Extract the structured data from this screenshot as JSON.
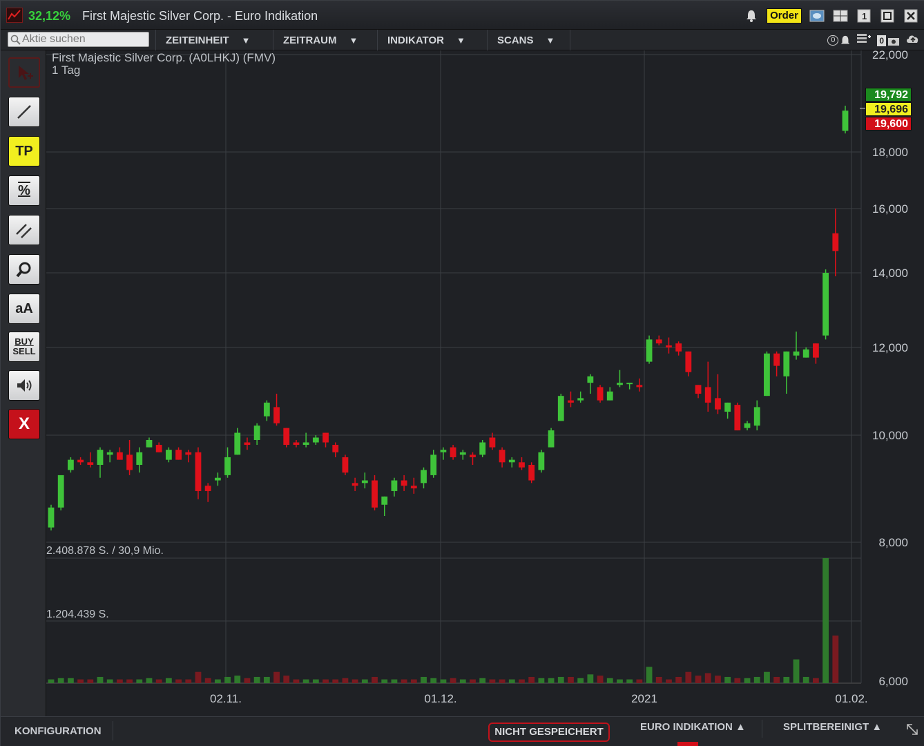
{
  "titlebar": {
    "change_pct": "32,12%",
    "title": "First Majestic Silver Corp. - Euro Indikation",
    "order_label": "Order"
  },
  "toolbar": {
    "search_placeholder": "Aktie suchen",
    "menus": [
      "ZEITEINHEIT",
      "ZEITRAUM",
      "INDIKATOR",
      "SCANS"
    ],
    "counter_a": "0",
    "counter_b": "0"
  },
  "tools": {
    "tp_label": "TP",
    "percent_label": "%",
    "text_label": "aA",
    "buy_label": "BUY",
    "sell_label": "SELL",
    "close_label": "X"
  },
  "chart": {
    "title_line1": "First Majestic Silver Corp. (A0LHKJ) (FMV)",
    "title_line2": "1 Tag",
    "volume_max_label": "2.408.878 S. / 30,9 Mio.",
    "volume_mid_label": "1.204.439 S.",
    "price_tags": {
      "high": "19,792",
      "last": "19,696",
      "low": "19,600"
    }
  },
  "colors": {
    "up": "#3fc33a",
    "down": "#e0101a",
    "background": "#1f2125",
    "grid": "#3b3e44",
    "accent_yellow": "#f2e416"
  },
  "chart_data": {
    "type": "candlestick",
    "title": "First Majestic Silver Corp. (A0LHKJ) (FMV)",
    "subtitle": "1 Tag",
    "y_ticks": [
      "22,000",
      "18,000",
      "16,000",
      "14,000",
      "12,000",
      "10,000",
      "8,000",
      "6,000"
    ],
    "x_ticks": [
      "02.11.",
      "01.12.",
      "2021",
      "01.02."
    ],
    "y_scale": "log",
    "ylim": [
      6.0,
      22.0
    ],
    "candles": [
      {
        "o": 8.25,
        "h": 8.65,
        "l": 8.2,
        "c": 8.6,
        "v": 0.03
      },
      {
        "o": 8.6,
        "h": 8.75,
        "l": 8.55,
        "c": 9.2,
        "v": 0.04
      },
      {
        "o": 9.3,
        "h": 9.55,
        "l": 9.25,
        "c": 9.5,
        "v": 0.04
      },
      {
        "o": 9.5,
        "h": 9.55,
        "l": 9.4,
        "c": 9.45,
        "v": 0.03
      },
      {
        "o": 9.45,
        "h": 9.65,
        "l": 9.35,
        "c": 9.4,
        "v": 0.03
      },
      {
        "o": 9.4,
        "h": 9.75,
        "l": 9.15,
        "c": 9.7,
        "v": 0.05
      },
      {
        "o": 9.6,
        "h": 9.7,
        "l": 9.45,
        "c": 9.65,
        "v": 0.03
      },
      {
        "o": 9.65,
        "h": 9.75,
        "l": 9.5,
        "c": 9.5,
        "v": 0.03
      },
      {
        "o": 9.6,
        "h": 9.9,
        "l": 9.2,
        "c": 9.3,
        "v": 0.03
      },
      {
        "o": 9.4,
        "h": 9.75,
        "l": 9.25,
        "c": 9.65,
        "v": 0.03
      },
      {
        "o": 9.75,
        "h": 9.95,
        "l": 9.75,
        "c": 9.9,
        "v": 0.04
      },
      {
        "o": 9.8,
        "h": 9.85,
        "l": 9.65,
        "c": 9.65,
        "v": 0.03
      },
      {
        "o": 9.5,
        "h": 9.75,
        "l": 9.45,
        "c": 9.7,
        "v": 0.04
      },
      {
        "o": 9.7,
        "h": 9.75,
        "l": 9.5,
        "c": 9.5,
        "v": 0.03
      },
      {
        "o": 9.65,
        "h": 9.7,
        "l": 9.45,
        "c": 9.6,
        "v": 0.03
      },
      {
        "o": 9.65,
        "h": 9.75,
        "l": 8.75,
        "c": 8.9,
        "v": 0.09
      },
      {
        "o": 9.0,
        "h": 9.05,
        "l": 8.7,
        "c": 8.9,
        "v": 0.04
      },
      {
        "o": 9.1,
        "h": 9.25,
        "l": 9.0,
        "c": 9.15,
        "v": 0.03
      },
      {
        "o": 9.2,
        "h": 9.75,
        "l": 9.15,
        "c": 9.55,
        "v": 0.05
      },
      {
        "o": 9.6,
        "h": 10.15,
        "l": 9.6,
        "c": 10.05,
        "v": 0.06
      },
      {
        "o": 9.85,
        "h": 9.95,
        "l": 9.7,
        "c": 9.8,
        "v": 0.04
      },
      {
        "o": 9.9,
        "h": 10.25,
        "l": 9.8,
        "c": 10.2,
        "v": 0.05
      },
      {
        "o": 10.4,
        "h": 10.75,
        "l": 10.3,
        "c": 10.7,
        "v": 0.05
      },
      {
        "o": 10.6,
        "h": 10.9,
        "l": 10.2,
        "c": 10.25,
        "v": 0.09
      },
      {
        "o": 10.15,
        "h": 10.15,
        "l": 9.75,
        "c": 9.8,
        "v": 0.06
      },
      {
        "o": 9.85,
        "h": 9.9,
        "l": 9.75,
        "c": 9.8,
        "v": 0.03
      },
      {
        "o": 9.8,
        "h": 10.05,
        "l": 9.75,
        "c": 9.85,
        "v": 0.03
      },
      {
        "o": 9.85,
        "h": 10.0,
        "l": 9.8,
        "c": 9.95,
        "v": 0.03
      },
      {
        "o": 10.05,
        "h": 10.05,
        "l": 9.75,
        "c": 9.85,
        "v": 0.03
      },
      {
        "o": 9.8,
        "h": 9.85,
        "l": 9.55,
        "c": 9.65,
        "v": 0.03
      },
      {
        "o": 9.55,
        "h": 9.6,
        "l": 9.2,
        "c": 9.25,
        "v": 0.04
      },
      {
        "o": 9.05,
        "h": 9.15,
        "l": 8.9,
        "c": 9.0,
        "v": 0.03
      },
      {
        "o": 9.05,
        "h": 9.25,
        "l": 8.95,
        "c": 9.1,
        "v": 0.03
      },
      {
        "o": 9.1,
        "h": 9.2,
        "l": 8.55,
        "c": 8.6,
        "v": 0.05
      },
      {
        "o": 8.65,
        "h": 8.8,
        "l": 8.45,
        "c": 8.8,
        "v": 0.03
      },
      {
        "o": 8.9,
        "h": 9.15,
        "l": 8.8,
        "c": 9.1,
        "v": 0.03
      },
      {
        "o": 9.1,
        "h": 9.2,
        "l": 8.9,
        "c": 9.0,
        "v": 0.03
      },
      {
        "o": 9.0,
        "h": 9.15,
        "l": 8.85,
        "c": 8.95,
        "v": 0.03
      },
      {
        "o": 9.05,
        "h": 9.35,
        "l": 8.95,
        "c": 9.3,
        "v": 0.05
      },
      {
        "o": 9.2,
        "h": 9.7,
        "l": 9.15,
        "c": 9.6,
        "v": 0.04
      },
      {
        "o": 9.65,
        "h": 9.75,
        "l": 9.5,
        "c": 9.7,
        "v": 0.03
      },
      {
        "o": 9.75,
        "h": 9.8,
        "l": 9.5,
        "c": 9.55,
        "v": 0.04
      },
      {
        "o": 9.6,
        "h": 9.7,
        "l": 9.5,
        "c": 9.65,
        "v": 0.03
      },
      {
        "o": 9.6,
        "h": 9.65,
        "l": 9.4,
        "c": 9.55,
        "v": 0.03
      },
      {
        "o": 9.6,
        "h": 9.9,
        "l": 9.55,
        "c": 9.85,
        "v": 0.04
      },
      {
        "o": 9.95,
        "h": 10.05,
        "l": 9.7,
        "c": 9.75,
        "v": 0.03
      },
      {
        "o": 9.7,
        "h": 9.75,
        "l": 9.35,
        "c": 9.45,
        "v": 0.03
      },
      {
        "o": 9.45,
        "h": 9.55,
        "l": 9.35,
        "c": 9.5,
        "v": 0.03
      },
      {
        "o": 9.45,
        "h": 9.55,
        "l": 9.3,
        "c": 9.35,
        "v": 0.03
      },
      {
        "o": 9.4,
        "h": 9.45,
        "l": 9.05,
        "c": 9.1,
        "v": 0.05
      },
      {
        "o": 9.3,
        "h": 9.7,
        "l": 9.25,
        "c": 9.65,
        "v": 0.04
      },
      {
        "o": 9.75,
        "h": 10.15,
        "l": 9.75,
        "c": 10.1,
        "v": 0.04
      },
      {
        "o": 10.3,
        "h": 10.9,
        "l": 10.3,
        "c": 10.85,
        "v": 0.05
      },
      {
        "o": 10.75,
        "h": 10.95,
        "l": 10.6,
        "c": 10.7,
        "v": 0.05
      },
      {
        "o": 10.75,
        "h": 10.95,
        "l": 10.7,
        "c": 10.8,
        "v": 0.04
      },
      {
        "o": 11.15,
        "h": 11.35,
        "l": 10.9,
        "c": 11.3,
        "v": 0.07
      },
      {
        "o": 11.05,
        "h": 11.1,
        "l": 10.7,
        "c": 10.75,
        "v": 0.06
      },
      {
        "o": 10.75,
        "h": 11.05,
        "l": 10.75,
        "c": 10.95,
        "v": 0.04
      },
      {
        "o": 11.1,
        "h": 11.45,
        "l": 11.05,
        "c": 11.15,
        "v": 0.03
      },
      {
        "o": 11.15,
        "h": 11.15,
        "l": 11.0,
        "c": 11.15,
        "v": 0.03
      },
      {
        "o": 11.1,
        "h": 11.25,
        "l": 10.95,
        "c": 11.05,
        "v": 0.03
      },
      {
        "o": 11.65,
        "h": 12.3,
        "l": 11.6,
        "c": 12.2,
        "v": 0.13
      },
      {
        "o": 12.2,
        "h": 12.3,
        "l": 12.05,
        "c": 12.1,
        "v": 0.05
      },
      {
        "o": 12.05,
        "h": 12.25,
        "l": 11.85,
        "c": 12.0,
        "v": 0.03
      },
      {
        "o": 12.1,
        "h": 12.15,
        "l": 11.8,
        "c": 11.9,
        "v": 0.05
      },
      {
        "o": 11.9,
        "h": 11.9,
        "l": 11.3,
        "c": 11.4,
        "v": 0.09
      },
      {
        "o": 11.1,
        "h": 11.1,
        "l": 10.8,
        "c": 10.9,
        "v": 0.06
      },
      {
        "o": 11.05,
        "h": 11.65,
        "l": 10.5,
        "c": 10.7,
        "v": 0.08
      },
      {
        "o": 10.8,
        "h": 11.35,
        "l": 10.45,
        "c": 10.55,
        "v": 0.06
      },
      {
        "o": 10.5,
        "h": 10.7,
        "l": 10.35,
        "c": 10.7,
        "v": 0.05
      },
      {
        "o": 10.65,
        "h": 10.7,
        "l": 10.1,
        "c": 10.1,
        "v": 0.04
      },
      {
        "o": 10.15,
        "h": 10.3,
        "l": 10.1,
        "c": 10.25,
        "v": 0.04
      },
      {
        "o": 10.2,
        "h": 10.75,
        "l": 10.1,
        "c": 10.6,
        "v": 0.05
      },
      {
        "o": 10.85,
        "h": 11.9,
        "l": 10.85,
        "c": 11.85,
        "v": 0.09
      },
      {
        "o": 11.85,
        "h": 11.9,
        "l": 11.3,
        "c": 11.55,
        "v": 0.05
      },
      {
        "o": 11.3,
        "h": 11.9,
        "l": 10.9,
        "c": 11.9,
        "v": 0.05
      },
      {
        "o": 11.8,
        "h": 12.4,
        "l": 11.7,
        "c": 11.9,
        "v": 0.19
      },
      {
        "o": 11.75,
        "h": 12.0,
        "l": 11.75,
        "c": 11.95,
        "v": 0.05
      },
      {
        "o": 12.1,
        "h": 12.1,
        "l": 11.6,
        "c": 11.75,
        "v": 0.04
      },
      {
        "o": 12.3,
        "h": 14.1,
        "l": 12.2,
        "c": 14.0,
        "v": 1.0
      },
      {
        "o": 15.2,
        "h": 16.0,
        "l": 13.9,
        "c": 14.65,
        "v": 0.38
      },
      {
        "o": 18.8,
        "h": 19.8,
        "l": 18.7,
        "c": 19.6,
        "v": 0.0
      }
    ],
    "last_price": 19.696,
    "day_high": 19.792,
    "day_low": 19.6,
    "volume_axis_max": 2408878
  }
}
